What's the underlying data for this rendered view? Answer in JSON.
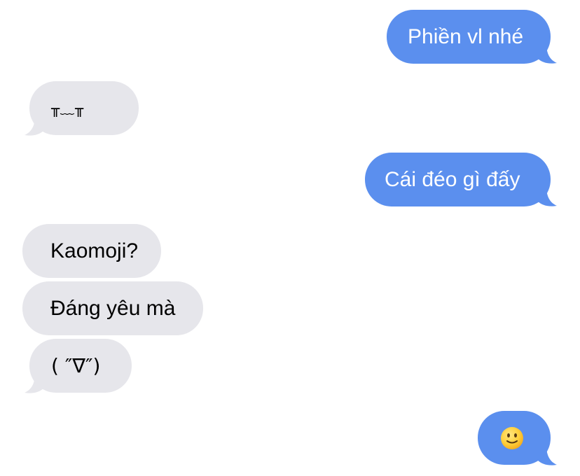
{
  "conversation": {
    "messages": [
      {
        "direction": "outgoing",
        "text": "Phiền vl nhé"
      },
      {
        "direction": "incoming",
        "text": "╥﹏╥"
      },
      {
        "direction": "outgoing",
        "text": "Cái đéo gì đấy"
      },
      {
        "direction": "incoming",
        "text": "Kaomoji?"
      },
      {
        "direction": "incoming",
        "text": "Đáng yêu mà"
      },
      {
        "direction": "incoming",
        "text": "( ″∇″)"
      },
      {
        "direction": "outgoing",
        "text": "🙂",
        "icon": "slightly-smiling-face-icon"
      }
    ]
  },
  "colors": {
    "outgoing_bubble": "#5b8fee",
    "incoming_bubble": "#e6e6eb",
    "outgoing_text": "#ffffff",
    "incoming_text": "#000000"
  }
}
